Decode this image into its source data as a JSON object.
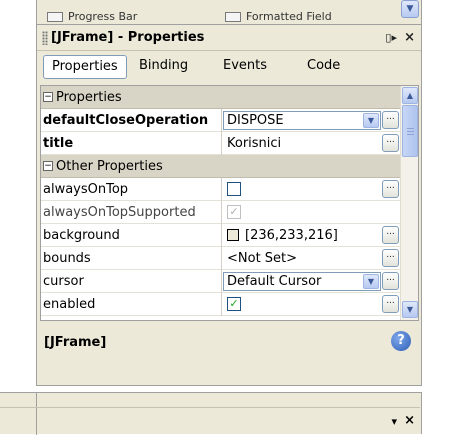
{
  "palette": {
    "items": [
      {
        "label": "Progress Bar"
      },
      {
        "label": "Formatted Field"
      }
    ]
  },
  "window": {
    "title": "[JFrame] - Properties",
    "tabs": [
      {
        "label": "Properties",
        "active": true
      },
      {
        "label": "Binding",
        "active": false
      },
      {
        "label": "Events",
        "active": false
      },
      {
        "label": "Code",
        "active": false
      }
    ]
  },
  "sheet": {
    "category1": "Properties",
    "category2": "Other Properties",
    "rows": {
      "defaultCloseOperation": {
        "name": "defaultCloseOperation",
        "value": "DISPOSE"
      },
      "title": {
        "name": "title",
        "value": "Korisnici"
      },
      "alwaysOnTop": {
        "name": "alwaysOnTop",
        "checked": false
      },
      "alwaysOnTopSupported": {
        "name": "alwaysOnTopSupported",
        "checked": true
      },
      "background": {
        "name": "background",
        "value": "[236,233,216]",
        "color": "#ece9d8"
      },
      "bounds": {
        "name": "bounds",
        "value": "<Not Set>"
      },
      "cursor": {
        "name": "cursor",
        "value": "Default Cursor"
      },
      "enabled": {
        "name": "enabled",
        "checked": true
      }
    },
    "ellipsis": "..."
  },
  "description": {
    "text": "[JFrame]",
    "help_glyph": "?"
  },
  "icons": {
    "close": "×",
    "minimize": "▯▸",
    "collapse": "−",
    "check": "✓",
    "arrow_down": "▼",
    "arrow_up": "▲",
    "menu": "▾"
  },
  "colors": {
    "accent": "#2f5fb6",
    "panel_bg": "#ece9d8"
  }
}
